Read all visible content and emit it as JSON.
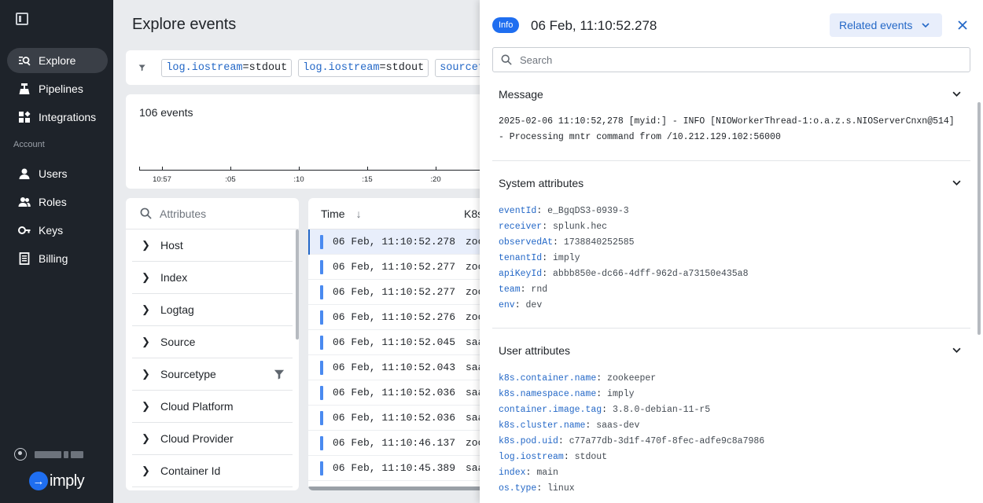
{
  "sidebar": {
    "collapse_icon": "sidebar-collapse-icon",
    "nav": [
      {
        "label": "Explore",
        "icon": "explore-icon",
        "active": true
      },
      {
        "label": "Pipelines",
        "icon": "pipelines-icon",
        "active": false
      },
      {
        "label": "Integrations",
        "icon": "integrations-icon",
        "active": false
      }
    ],
    "section_label": "Account",
    "account_nav": [
      {
        "label": "Users",
        "icon": "user-icon"
      },
      {
        "label": "Roles",
        "icon": "roles-icon"
      },
      {
        "label": "Keys",
        "icon": "key-icon"
      },
      {
        "label": "Billing",
        "icon": "billing-icon"
      }
    ],
    "logo_text": "imply",
    "colors": {
      "background": "#1e232a",
      "active": "#3a3f47",
      "logo": "#1f6ef0"
    }
  },
  "main": {
    "title": "Explore events",
    "filters": [
      {
        "key": "log.iostream",
        "op": "=",
        "value": "stdout"
      },
      {
        "key": "log.iostream",
        "op": "=",
        "value": "stdout"
      },
      {
        "key": "sourcety",
        "op": "",
        "value": ""
      }
    ],
    "histogram": {
      "count_text": "106 events",
      "ticks": [
        "10:57",
        ":05",
        ":10",
        ":15",
        ":20"
      ]
    },
    "attributes": {
      "search_placeholder": "Attributes",
      "items": [
        "Host",
        "Index",
        "Logtag",
        "Source",
        "Sourcetype",
        "Cloud Platform",
        "Cloud Provider",
        "Container Id"
      ]
    },
    "events": {
      "time_header": "Time",
      "k8s_header": "K8s",
      "rows": [
        {
          "time": "06 Feb, 11:10:52.278",
          "k8s": "zoo",
          "selected": true
        },
        {
          "time": "06 Feb, 11:10:52.277",
          "k8s": "zoo",
          "selected": false
        },
        {
          "time": "06 Feb, 11:10:52.277",
          "k8s": "zoo",
          "selected": false
        },
        {
          "time": "06 Feb, 11:10:52.276",
          "k8s": "zoo",
          "selected": false
        },
        {
          "time": "06 Feb, 11:10:52.045",
          "k8s": "saa",
          "selected": false
        },
        {
          "time": "06 Feb, 11:10:52.043",
          "k8s": "saa",
          "selected": false
        },
        {
          "time": "06 Feb, 11:10:52.036",
          "k8s": "saa",
          "selected": false
        },
        {
          "time": "06 Feb, 11:10:52.036",
          "k8s": "saa",
          "selected": false
        },
        {
          "time": "06 Feb, 11:10:46.137",
          "k8s": "zoo",
          "selected": false
        },
        {
          "time": "06 Feb, 11:10:45.389",
          "k8s": "saa",
          "selected": false
        }
      ]
    }
  },
  "detail": {
    "badge": "Info",
    "title": "06 Feb, 11:10:52.278",
    "related_label": "Related events",
    "search_placeholder": "Search",
    "message": {
      "title": "Message",
      "text": "2025-02-06 11:10:52,278 [myid:] - INFO [NIOWorkerThread-1:o.a.z.s.NIOServerCnxn@514] - Processing mntr command from /10.212.129.102:56000"
    },
    "system": {
      "title": "System attributes",
      "items": [
        {
          "key": "eventId",
          "value": "e_BgqDS3-0939-3"
        },
        {
          "key": "receiver",
          "value": "splunk.hec"
        },
        {
          "key": "observedAt",
          "value": "1738840252585"
        },
        {
          "key": "tenantId",
          "value": "imply"
        },
        {
          "key": "apiKeyId",
          "value": "abbb850e-dc66-4dff-962d-a73150e435a8"
        },
        {
          "key": "team",
          "value": "rnd"
        },
        {
          "key": "env",
          "value": "dev"
        }
      ]
    },
    "user": {
      "title": "User attributes",
      "items": [
        {
          "key": "k8s.container.name",
          "value": "zookeeper"
        },
        {
          "key": "k8s.namespace.name",
          "value": "imply"
        },
        {
          "key": "container.image.tag",
          "value": "3.8.0-debian-11-r5"
        },
        {
          "key": "k8s.cluster.name",
          "value": "saas-dev"
        },
        {
          "key": "k8s.pod.uid",
          "value": "c77a77db-3d1f-470f-8fec-adfe9c8a7986"
        },
        {
          "key": "log.iostream",
          "value": "stdout"
        },
        {
          "key": "index",
          "value": "main"
        },
        {
          "key": "os.type",
          "value": "linux"
        }
      ]
    },
    "colors": {
      "badge": "#1f6ef0",
      "key": "#2468c7"
    }
  }
}
